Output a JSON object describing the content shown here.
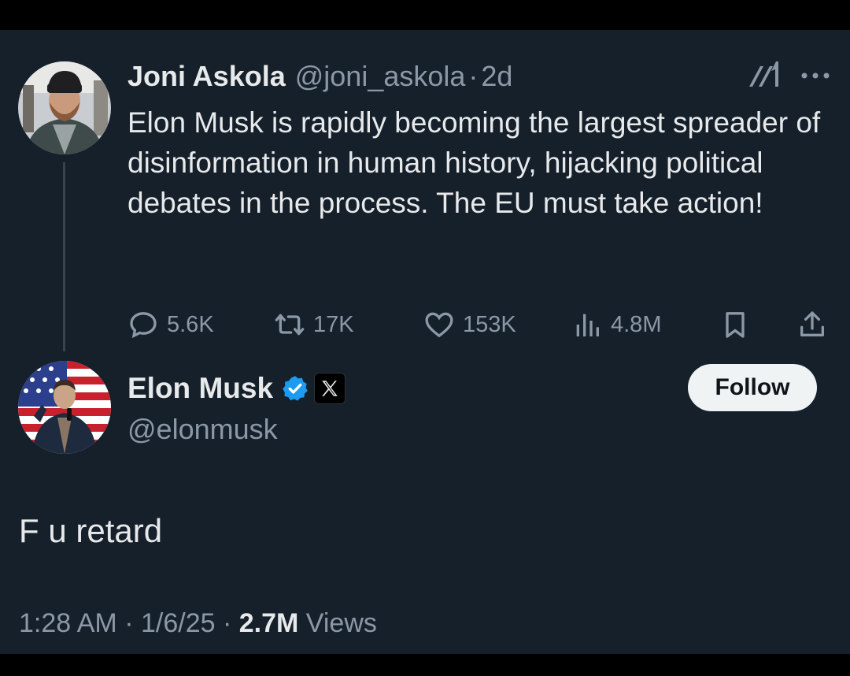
{
  "parent_tweet": {
    "display_name": "Joni Askola",
    "handle": "@joni_askola",
    "separator": "·",
    "age": "2d",
    "text": "Elon Musk is rapidly becoming the largest spreader of disinformation in human history, hijacking political debates in the process. The EU must take action!",
    "actions": {
      "replies": "5.6K",
      "reposts": "17K",
      "likes": "153K",
      "views": "4.8M"
    },
    "icons": [
      "grok-icon",
      "more-icon",
      "reply-icon",
      "retweet-icon",
      "heart-icon",
      "views-icon",
      "bookmark-icon",
      "share-icon"
    ]
  },
  "reply_tweet": {
    "display_name": "Elon Musk",
    "handle": "@elonmusk",
    "follow_label": "Follow",
    "text": "F u retard",
    "time": "1:28 AM",
    "sep1": "·",
    "date": "1/6/25",
    "sep2": "·",
    "views_count": "2.7M",
    "views_label": "Views",
    "icons": [
      "verified-icon",
      "x-affiliation-icon"
    ]
  },
  "colors": {
    "background": "#15202b",
    "text_primary": "#e7e9ea",
    "text_secondary": "#8b98a5",
    "verified_blue": "#1d9bf0",
    "follow_bg": "#eff3f4"
  }
}
